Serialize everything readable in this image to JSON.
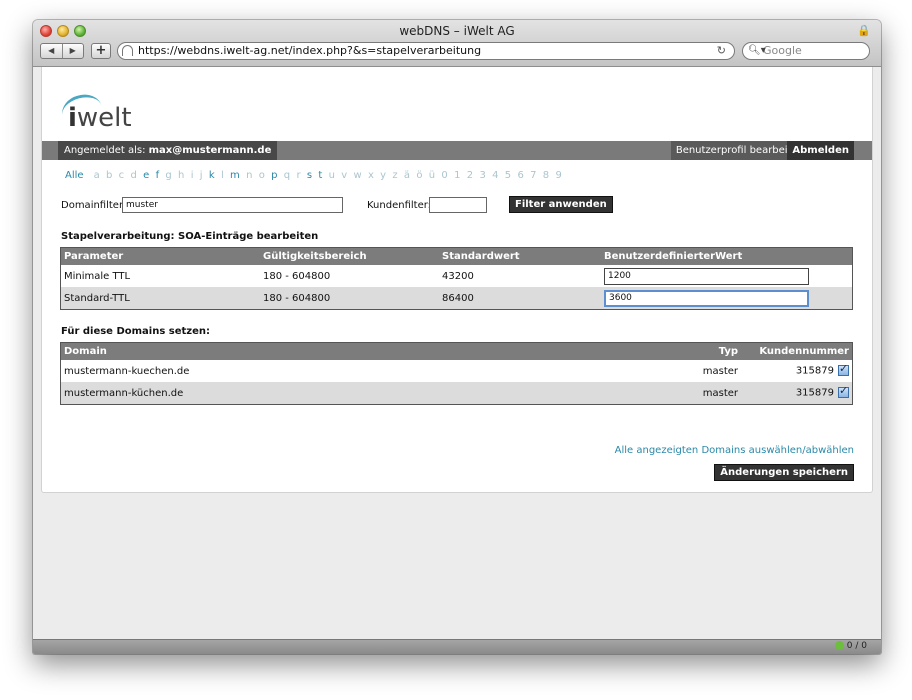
{
  "window": {
    "title": "webDNS – iWelt AG"
  },
  "browser": {
    "url": "https://webdns.iwelt-ag.net/index.php?&s=stapelverarbeitung",
    "search_placeholder": "Google",
    "add_label": "+",
    "status": "0 / 0"
  },
  "logo": {
    "i": "i",
    "text": "welt"
  },
  "userbar": {
    "logged_in_prefix": "Angemeldet als: ",
    "user": "max@mustermann.de",
    "profile_label": "Benutzerprofil bearbeiten",
    "logout_label": "Abmelden"
  },
  "alphabet": {
    "all_label": "Alle",
    "letters": [
      "a",
      "b",
      "c",
      "d",
      "e",
      "f",
      "g",
      "h",
      "i",
      "j",
      "k",
      "l",
      "m",
      "n",
      "o",
      "p",
      "q",
      "r",
      "s",
      "t",
      "u",
      "v",
      "w",
      "x",
      "y",
      "z",
      "ä",
      "ö",
      "ü",
      "0",
      "1",
      "2",
      "3",
      "4",
      "5",
      "6",
      "7",
      "8",
      "9"
    ],
    "active": [
      "e",
      "f",
      "k",
      "m",
      "p",
      "s",
      "t"
    ]
  },
  "filters": {
    "domain_label": "Domainfilter:",
    "domain_value": "muster",
    "customer_label": "Kundenfilter:",
    "customer_value": "",
    "apply_label": "Filter anwenden"
  },
  "soa": {
    "title": "Stapelverarbeitung: SOA-Einträge bearbeiten",
    "headers": [
      "Parameter",
      "Gültigkeitsbereich",
      "Standardwert",
      "BenutzerdefinierterWert"
    ],
    "rows": [
      {
        "param": "Minimale TTL",
        "range": "180 - 604800",
        "default": "43200",
        "custom": "1200"
      },
      {
        "param": "Standard-TTL",
        "range": "180 - 604800",
        "default": "86400",
        "custom": "3600"
      }
    ]
  },
  "domains": {
    "title": "Für diese Domains setzen:",
    "headers": [
      "Domain",
      "Typ",
      "Kundennummer"
    ],
    "rows": [
      {
        "domain": "mustermann-kuechen.de",
        "type": "master",
        "customer": "315879"
      },
      {
        "domain": "mustermann-küchen.de",
        "type": "master",
        "customer": "315879"
      }
    ],
    "select_all_label": "Alle angezeigten Domains auswählen/abwählen",
    "save_label": "Änderungen speichern"
  }
}
